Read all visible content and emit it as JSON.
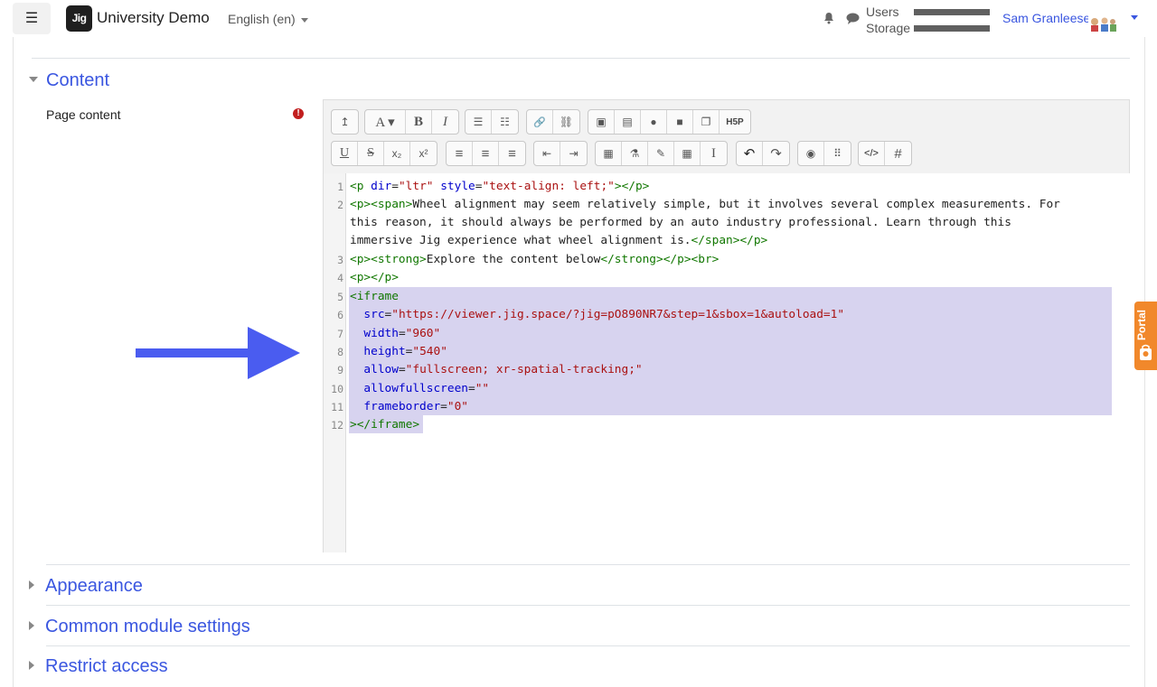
{
  "navbar": {
    "menu_icon": "hamburger-icon",
    "logo_text": "Jig",
    "site_name": "University Demo",
    "language": "English (en)",
    "notifications_icon": "bell-icon",
    "messages_icon": "chat-icon",
    "quota": [
      {
        "label": "Users"
      },
      {
        "label": "Storage"
      }
    ],
    "user_name": "Sam Granleese",
    "user_caret_icon": "caret-down-icon"
  },
  "sections": {
    "content": "Content",
    "appearance": "Appearance",
    "common": "Common module settings",
    "restrict": "Restrict access"
  },
  "field": {
    "label": "Page content",
    "required_icon": "exclamation-icon",
    "required_mark": "!"
  },
  "toolbar": {
    "row1": [
      {
        "name": "collapse",
        "icon": "collapse-icon",
        "label": "↥"
      },
      {
        "name": "font",
        "icon": "font-icon",
        "label": "A ▾"
      },
      {
        "name": "bold",
        "icon": "bold-icon",
        "label": "B"
      },
      {
        "name": "italic",
        "icon": "italic-icon",
        "label": "I"
      },
      {
        "name": "bullet-list",
        "icon": "bullet-list-icon",
        "label": "☰"
      },
      {
        "name": "numbered-list",
        "icon": "numbered-list-icon",
        "label": "☷"
      },
      {
        "name": "link",
        "icon": "link-icon",
        "label": "🔗"
      },
      {
        "name": "unlink",
        "icon": "unlink-icon",
        "label": "⛓"
      },
      {
        "name": "image",
        "icon": "image-icon",
        "label": "▣"
      },
      {
        "name": "media",
        "icon": "media-icon",
        "label": "▤"
      },
      {
        "name": "record-audio",
        "icon": "microphone-icon",
        "label": "●"
      },
      {
        "name": "record-video",
        "icon": "video-camera-icon",
        "label": "■"
      },
      {
        "name": "manage-files",
        "icon": "files-icon",
        "label": "❐"
      },
      {
        "name": "h5p",
        "icon": "h5p-icon",
        "label": "H5P"
      }
    ],
    "row2": [
      {
        "name": "underline",
        "icon": "underline-icon",
        "label": "U"
      },
      {
        "name": "strikethrough",
        "icon": "strikethrough-icon",
        "label": "S"
      },
      {
        "name": "subscript",
        "icon": "subscript-icon",
        "label": "x₂"
      },
      {
        "name": "superscript",
        "icon": "superscript-icon",
        "label": "x²"
      },
      {
        "name": "align-left",
        "icon": "align-left-icon",
        "label": "≡"
      },
      {
        "name": "align-center",
        "icon": "align-center-icon",
        "label": "≡"
      },
      {
        "name": "align-right",
        "icon": "align-right-icon",
        "label": "≡"
      },
      {
        "name": "outdent",
        "icon": "outdent-icon",
        "label": "⇤"
      },
      {
        "name": "indent",
        "icon": "indent-icon",
        "label": "⇥"
      },
      {
        "name": "equation",
        "icon": "calculator-icon",
        "label": "▦"
      },
      {
        "name": "chemistry",
        "icon": "flask-icon",
        "label": "⚗"
      },
      {
        "name": "special-chars",
        "icon": "pencil-icon",
        "label": "✎"
      },
      {
        "name": "table",
        "icon": "table-icon",
        "label": "▦"
      },
      {
        "name": "clear-format",
        "icon": "text-cursor-icon",
        "label": "I"
      },
      {
        "name": "undo",
        "icon": "undo-icon",
        "label": "↶"
      },
      {
        "name": "redo",
        "icon": "redo-icon",
        "label": "↷"
      },
      {
        "name": "accessibility-checker",
        "icon": "accessibility-icon",
        "label": "◉"
      },
      {
        "name": "screenreader-helper",
        "icon": "braille-icon",
        "label": "⠿"
      },
      {
        "name": "html",
        "icon": "code-icon",
        "label": "</>"
      },
      {
        "name": "html-tidy",
        "icon": "hash-icon",
        "label": "#"
      }
    ]
  },
  "code": {
    "line_numbers": [
      "1",
      "2",
      "3",
      "4",
      "5",
      "6",
      "7",
      "8",
      "9",
      "10",
      "11",
      "12"
    ],
    "lines": [
      [
        {
          "t": "<p ",
          "c": "tg"
        },
        {
          "t": "dir",
          "c": "at"
        },
        {
          "t": "=",
          "c": ""
        },
        {
          "t": "\"ltr\"",
          "c": "vl"
        },
        {
          "t": " ",
          "c": ""
        },
        {
          "t": "style",
          "c": "at"
        },
        {
          "t": "=",
          "c": ""
        },
        {
          "t": "\"text-align: left;\"",
          "c": "vl"
        },
        {
          "t": "></p>",
          "c": "tg"
        }
      ],
      [
        {
          "t": "<p><span>",
          "c": "tg"
        },
        {
          "t": "Wheel alignment may seem relatively simple, but it involves several complex measurements. For",
          "c": ""
        }
      ],
      [
        {
          "t": "this reason, it should always be performed by an auto industry professional. Learn through this",
          "c": ""
        }
      ],
      [
        {
          "t": "immersive Jig experience what wheel alignment is.",
          "c": ""
        },
        {
          "t": "</span></p>",
          "c": "tg"
        }
      ],
      [
        {
          "t": "<p><strong>",
          "c": "tg"
        },
        {
          "t": "Explore the content below",
          "c": ""
        },
        {
          "t": "</strong></p><br>",
          "c": "tg"
        }
      ],
      [
        {
          "t": "<p></p>",
          "c": "tg"
        }
      ],
      [
        {
          "t": "<iframe",
          "c": "tg"
        }
      ],
      [
        {
          "t": "  ",
          "c": ""
        },
        {
          "t": "src",
          "c": "at"
        },
        {
          "t": "=",
          "c": ""
        },
        {
          "t": "\"https://viewer.jig.space/?jig=pO890NR7&step=1&sbox=1&autoload=1\"",
          "c": "vl"
        }
      ],
      [
        {
          "t": "  ",
          "c": ""
        },
        {
          "t": "width",
          "c": "at"
        },
        {
          "t": "=",
          "c": ""
        },
        {
          "t": "\"960\"",
          "c": "vl"
        }
      ],
      [
        {
          "t": "  ",
          "c": ""
        },
        {
          "t": "height",
          "c": "at"
        },
        {
          "t": "=",
          "c": ""
        },
        {
          "t": "\"540\"",
          "c": "vl"
        }
      ],
      [
        {
          "t": "  ",
          "c": ""
        },
        {
          "t": "allow",
          "c": "at"
        },
        {
          "t": "=",
          "c": ""
        },
        {
          "t": "\"fullscreen; xr-spatial-tracking;\"",
          "c": "vl"
        }
      ],
      [
        {
          "t": "  ",
          "c": ""
        },
        {
          "t": "allowfullscreen",
          "c": "at"
        },
        {
          "t": "=",
          "c": ""
        },
        {
          "t": "\"\"",
          "c": "vl"
        }
      ],
      [
        {
          "t": "  ",
          "c": ""
        },
        {
          "t": "frameborder",
          "c": "at"
        },
        {
          "t": "=",
          "c": ""
        },
        {
          "t": "\"0\"",
          "c": "vl"
        }
      ],
      [
        {
          "t": "></iframe>",
          "c": "tg"
        }
      ]
    ]
  },
  "portal": {
    "label": "Portal",
    "icon": "portal-icon"
  },
  "annotation": {
    "icon": "arrow-right-icon",
    "color": "#4a5cf0"
  },
  "colors": {
    "accent": "#3a56e0",
    "highlight": "#d7d3ef",
    "portal": "#f1882b"
  }
}
